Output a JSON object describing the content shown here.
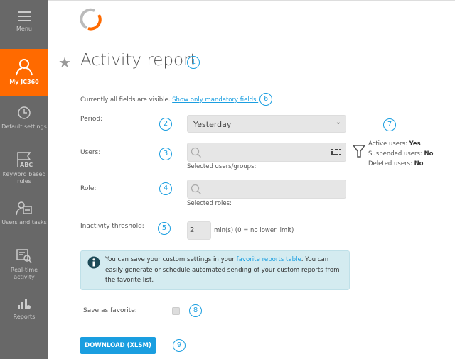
{
  "sidebar": {
    "items": [
      {
        "label": "Menu",
        "icon": "hamburger-icon"
      },
      {
        "label": "My JC360",
        "icon": "user-icon",
        "active": true
      },
      {
        "label": "Default settings",
        "icon": "clock-icon"
      },
      {
        "label": "Keyword based rules",
        "icon": "flag-abc-icon"
      },
      {
        "label": "Users and tasks",
        "icon": "users-tasks-icon"
      },
      {
        "label": "Real-time activity",
        "icon": "monitor-search-icon"
      },
      {
        "label": "Reports",
        "icon": "bar-chart-icon"
      }
    ]
  },
  "page": {
    "title": "Activity report",
    "title_marker": "1",
    "visibility_text": "Currently all fields are visible.",
    "visibility_link": "Show only mandatory fields.",
    "visibility_marker": "6"
  },
  "form": {
    "period": {
      "label": "Period:",
      "value": "Yesterday",
      "marker": "2"
    },
    "users": {
      "label": "Users:",
      "placeholder": "",
      "marker": "3",
      "selected_label": "Selected users/groups:"
    },
    "filter": {
      "marker": "7",
      "active_label": "Active users:",
      "active_value": "Yes",
      "suspended_label": "Suspended users:",
      "suspended_value": "No",
      "deleted_label": "Deleted users:",
      "deleted_value": "No"
    },
    "role": {
      "label": "Role:",
      "placeholder": "",
      "marker": "4",
      "selected_label": "Selected roles:"
    },
    "inactivity": {
      "label": "Inactivity threshold:",
      "value": "2",
      "unit": "min(s) (0 = no lower limit)",
      "marker": "5"
    },
    "info": {
      "text1": "You can save your custom settings in your ",
      "link": "favorite reports table",
      "text2": ". You can easily generate or schedule automated sending of your custom reports from the favorite list."
    },
    "favorite": {
      "label": "Save as favorite:",
      "checked": false,
      "marker": "8"
    },
    "download": {
      "label": "DOWNLOAD (XLSM)",
      "marker": "9"
    }
  },
  "colors": {
    "accent": "#ff6a00",
    "primary": "#1a9ee0",
    "sidebar": "#686868",
    "info_bg": "#d4ebf0"
  }
}
